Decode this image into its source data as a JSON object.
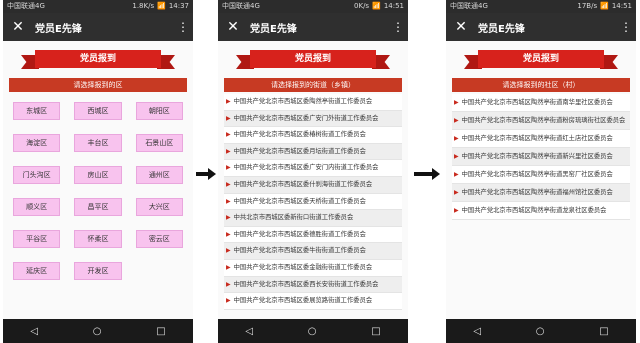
{
  "common": {
    "app_title": "党员E先锋",
    "banner": "党员报到",
    "close_glyph": "✕",
    "more_glyph": "⋮",
    "nav": {
      "back": "◁",
      "home": "○",
      "recent": "□"
    }
  },
  "screen1": {
    "status_left": "中国联通4G",
    "status_right": [
      "1.8K/s",
      "📶",
      "14:37"
    ],
    "subheading": "请选择报到的区",
    "districts": [
      "东城区",
      "西城区",
      "朝阳区",
      "海淀区",
      "丰台区",
      "石景山区",
      "门头沟区",
      "房山区",
      "通州区",
      "顺义区",
      "昌平区",
      "大兴区",
      "平谷区",
      "怀柔区",
      "密云区",
      "延庆区",
      "开发区"
    ]
  },
  "screen2": {
    "status_left": "中国联通4G",
    "status_right": [
      "0K/s",
      "📶",
      "14:51"
    ],
    "subheading": "请选择报到的街道（乡镇）",
    "streets": [
      "中国共产党北京市西城区委陶然亭街道工作委员会",
      "中国共产党北京市西城区委广安门外街道工作委员会",
      "中国共产党北京市西城区委椿树街道工作委员会",
      "中国共产党北京市西城区委月坛街道工作委员会",
      "中国共产党北京市西城区委广安门内街道工作委员会",
      "中国共产党北京市西城区委什刹海街道工作委员会",
      "中国共产党北京市西城区委天桥街道工作委员会",
      "中共北京市西城区委新街口街道工作委员会",
      "中国共产党北京市西城区委德胜街道工作委员会",
      "中国共产党北京市西城区委牛街街道工作委员会",
      "中国共产党北京市西城区委金融街街道工作委员会",
      "中国共产党北京市西城区委西长安街街道工作委员会",
      "中国共产党北京市西城区委展览路街道工作委员会"
    ]
  },
  "screen3": {
    "status_left": "中国联通4G",
    "status_right": [
      "17B/s",
      "📶",
      "14:51"
    ],
    "subheading": "请选择报到的社区（村）",
    "communities": [
      "中国共产党北京市西城区陶然亭街道南华里社区委员会",
      "中国共产党北京市西城区陶然亭街道粉房琉璃街社区委员会",
      "中国共产党北京市西城区陶然亭街道红土店社区委员会",
      "中国共产党北京市西城区陶然亭街道新兴里社区委员会",
      "中国共产党北京市西城区陶然亭街道黑窑厂社区委员会",
      "中国共产党北京市西城区陶然亭街道福州馆社区委员会",
      "中国共产党北京市西城区陶然亭街道龙泉社区委员会"
    ]
  }
}
